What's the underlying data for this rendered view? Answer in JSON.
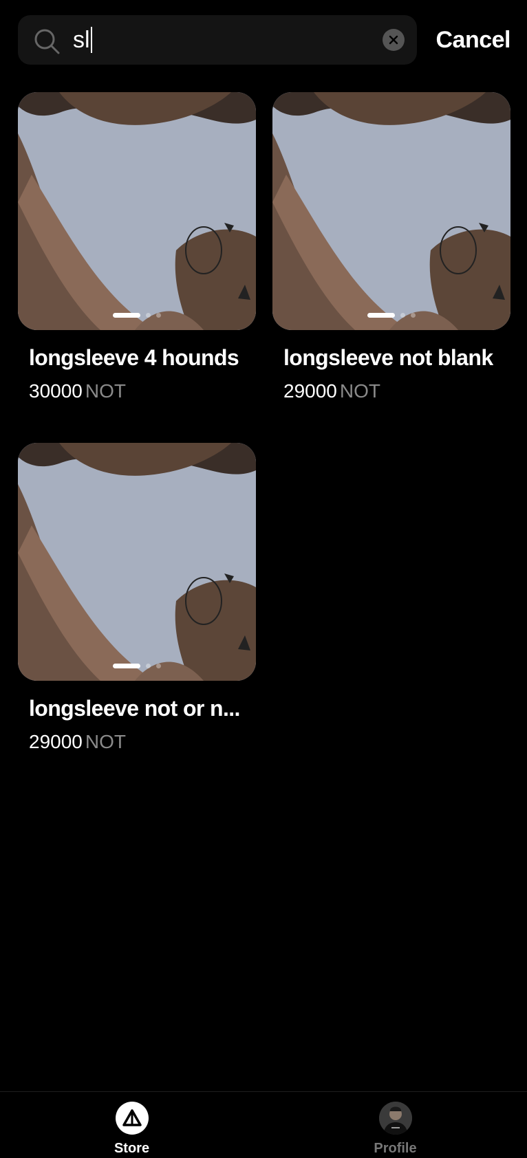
{
  "search": {
    "query": "sl",
    "cancel_label": "Cancel"
  },
  "products": [
    {
      "title": "longsleeve 4 hounds",
      "price": "30000",
      "currency": "NOT"
    },
    {
      "title": "longsleeve not blank",
      "price": "29000",
      "currency": "NOT"
    },
    {
      "title": "longsleeve not or n...",
      "price": "29000",
      "currency": "NOT"
    }
  ],
  "tabbar": {
    "store_label": "Store",
    "profile_label": "Profile",
    "active_tab": "Store"
  },
  "icons": {
    "search": "search-icon",
    "clear": "clear-icon",
    "store": "store-icon",
    "profile": "profile-avatar"
  }
}
